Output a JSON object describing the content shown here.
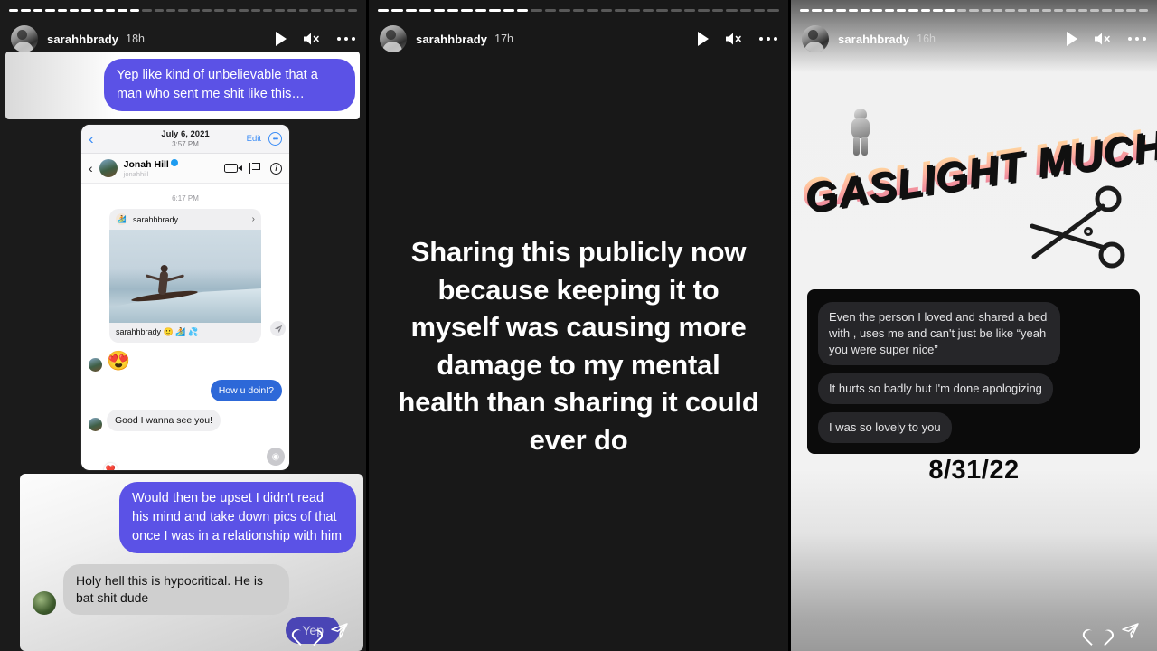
{
  "stories": [
    {
      "id": "story-1",
      "progress_total": 29,
      "progress_done": 11,
      "username": "sarahhbrady",
      "time": "18h",
      "icons": {
        "play": "play-icon",
        "mute": "mute-icon",
        "more": "more-options-icon"
      },
      "top_card": {
        "bubble": "Yep like kind of unbelievable that a man who sent me shit like this…"
      },
      "phone_screenshot": {
        "nav": {
          "back": "‹",
          "date": "July 6, 2021",
          "time": "3:57 PM",
          "edit": "Edit",
          "more": "•••"
        },
        "thread": {
          "back": "‹",
          "name": "Jonah Hill",
          "handle": "jonahhill",
          "verified": true,
          "icons": [
            "video-call-icon",
            "flag-icon",
            "info-icon"
          ]
        },
        "timestamp": "6:17 PM",
        "shared_post": {
          "account": "sarahhbrady",
          "caption": "sarahhbrady 🙂 🏄 💦"
        },
        "messages": [
          {
            "side": "left",
            "type": "emoji",
            "text": "😍",
            "reaction": "❤️"
          },
          {
            "side": "right",
            "type": "text",
            "text": "How u doin!?"
          },
          {
            "side": "left",
            "type": "text",
            "text": "Good I wanna see you!"
          }
        ]
      },
      "bottom_card": {
        "blue_bubble": "Would then be upset I didn't read his mind and take down pics of that once I was in a relationship with him",
        "grey_bubble": "Holy hell this is hypocritical. He is bat shit dude",
        "reply_chip": "Yep"
      },
      "actions": {
        "like": "heart-icon",
        "share": "send-icon"
      }
    },
    {
      "id": "story-2",
      "progress_total": 29,
      "progress_done": 11,
      "username": "sarahhbrady",
      "time": "17h",
      "icons": {
        "play": "play-icon",
        "mute": "mute-icon",
        "more": "more-options-icon"
      },
      "quote": "Sharing this publicly now because keeping it to myself was causing more damage to my mental health than sharing it could ever do"
    },
    {
      "id": "story-3",
      "progress_total": 29,
      "progress_done": 13,
      "username": "sarahhbrady",
      "time": "16h",
      "icons": {
        "play": "play-icon",
        "mute": "mute-icon",
        "more": "more-options-icon"
      },
      "sticker": {
        "text": "GASLIGHT MUCH?",
        "figure": "astronaut-icon",
        "scissors": "scissors-icon"
      },
      "dm_card": [
        "Even the person I loved and shared a bed with , uses me and can't just be like “yeah you were super nice”",
        "It hurts so badly but I'm done apologizing",
        "I was so lovely to you"
      ],
      "date_stamp": "8/31/22",
      "actions": {
        "like": "heart-icon",
        "share": "send-icon"
      }
    }
  ],
  "colors": {
    "blue_bubble": "#5b52e6",
    "ig_blue": "#2d68d8",
    "dm_bubble": "#262629",
    "dark_bg": "#1b1b1b"
  }
}
